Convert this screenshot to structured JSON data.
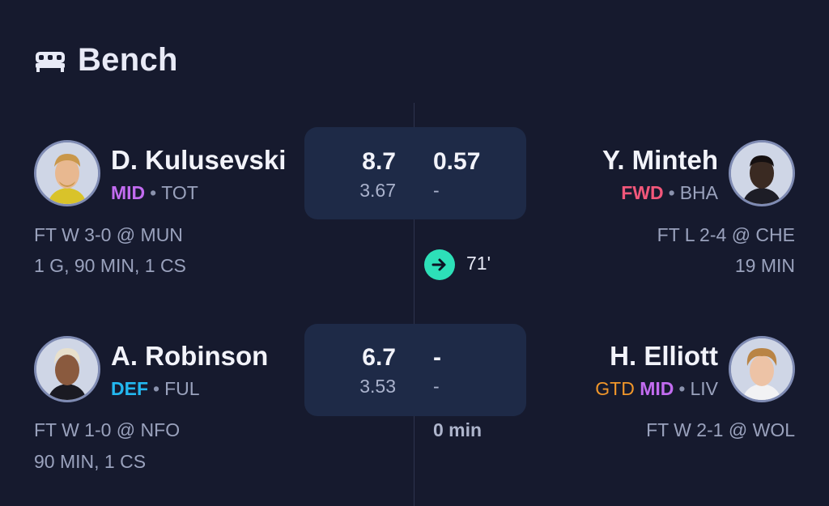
{
  "header": {
    "title": "Bench",
    "icon": "bed-icon"
  },
  "pairs": [
    {
      "left": {
        "name": "D. Kulusevski",
        "position": "MID",
        "team": "TOT",
        "fixture": "FT W 3-0 @ MUN",
        "stats": "1 G, 90 MIN, 1 CS",
        "points": "8.7",
        "sub_value": "3.67"
      },
      "right": {
        "name": "Y. Minteh",
        "position": "FWD",
        "team": "BHA",
        "fixture": "FT L 2-4 @ CHE",
        "stats": "19 MIN",
        "points": "0.57",
        "sub_value": "-"
      },
      "sub_time": "71'"
    },
    {
      "left": {
        "name": "A. Robinson",
        "position": "DEF",
        "team": "FUL",
        "fixture": "FT W 1-0 @ NFO",
        "stats": "90 MIN, 1 CS",
        "points": "6.7",
        "sub_value": "3.53"
      },
      "right": {
        "name": "H. Elliott",
        "status": "GTD",
        "position": "MID",
        "team": "LIV",
        "fixture": "FT W 2-1 @ WOL",
        "points": "-",
        "sub_value": "-"
      },
      "minutes_note": "0 min"
    }
  ],
  "separator": "•",
  "colors": {
    "background": "#161a2e",
    "card": "#1e2a47",
    "mid": "#c26cf0",
    "fwd": "#f2577a",
    "def": "#23b8f0",
    "gtd": "#f0962a",
    "sub_arrow": "#2de0b8"
  }
}
